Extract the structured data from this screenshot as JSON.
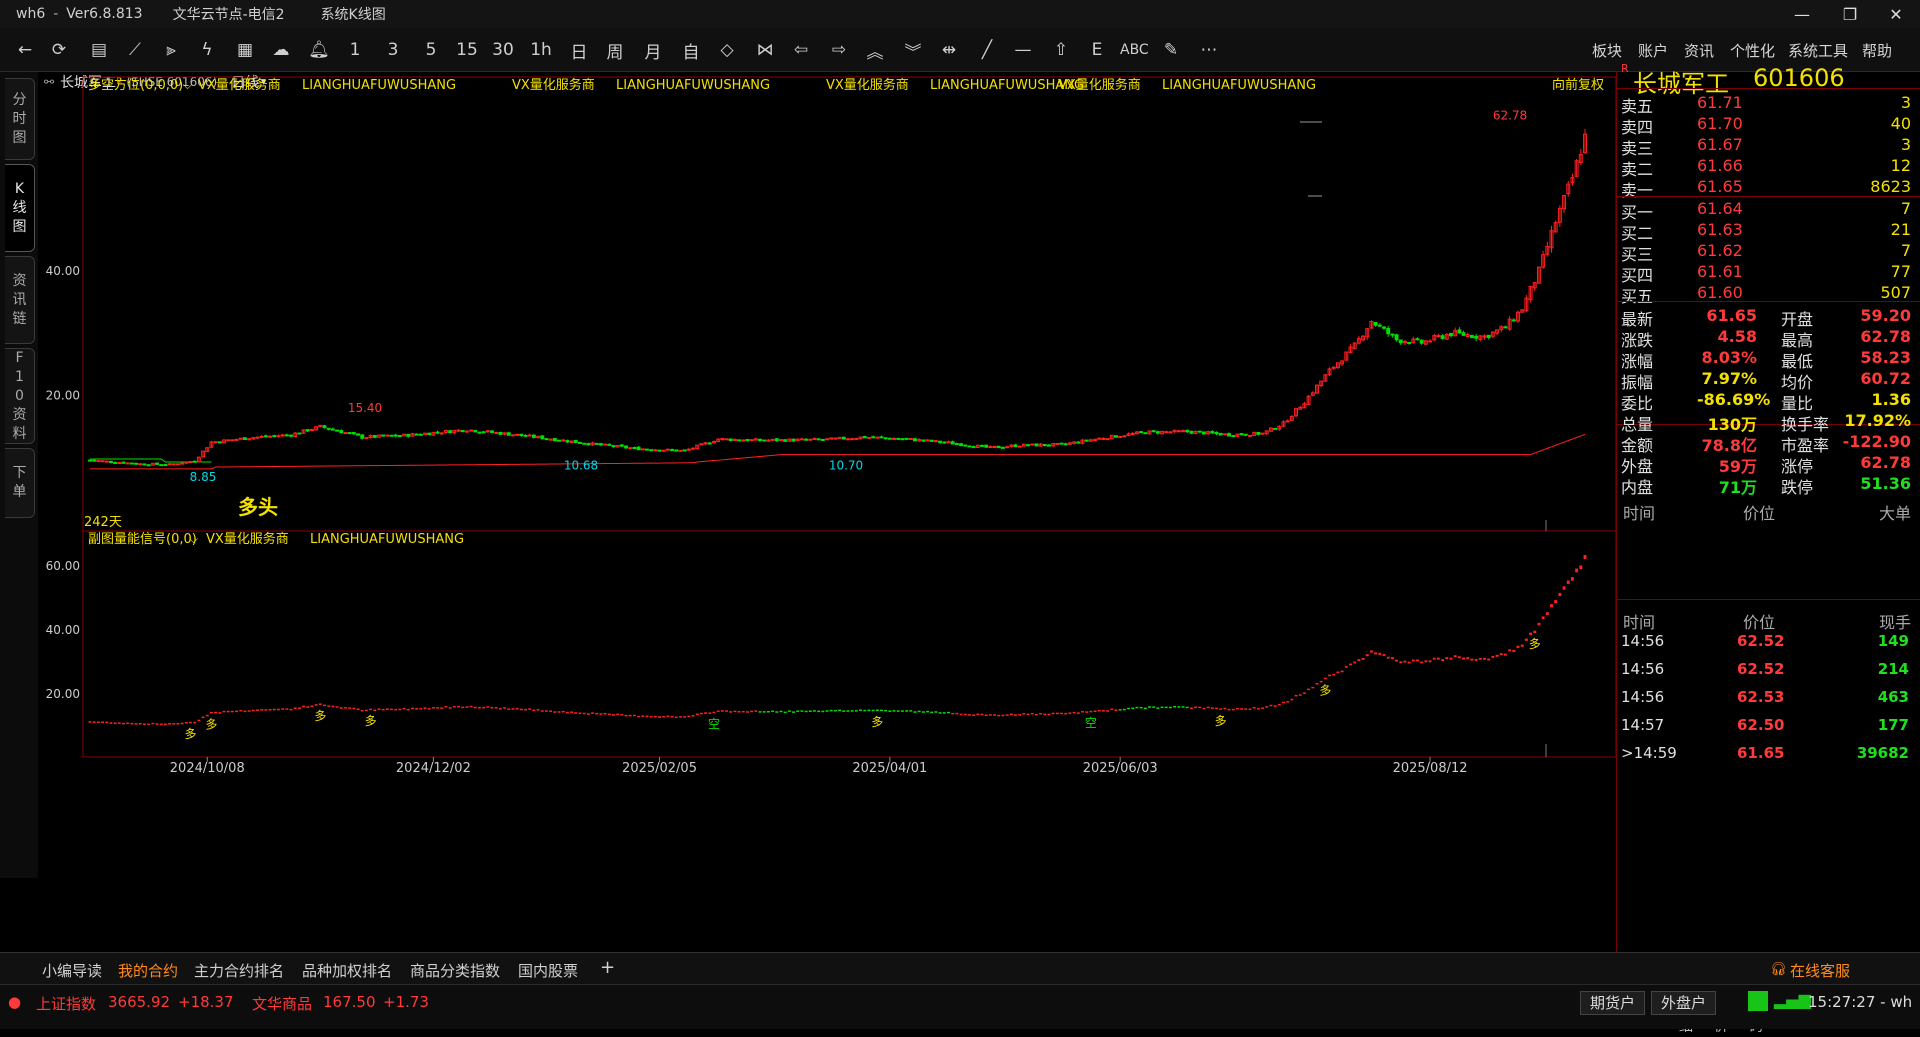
{
  "window": {
    "app": "wh6",
    "version": "Ver6.8.813",
    "server": "文华云节点-电信2",
    "view": "系统K线图"
  },
  "toolbar": {
    "periods": [
      "1",
      "3",
      "5",
      "15",
      "30",
      "1h",
      "日",
      "周",
      "月",
      "自"
    ],
    "extra_text": "ABC",
    "menus": [
      "板块",
      "账户",
      "资讯",
      "个性化",
      "系统工具",
      "帮助"
    ]
  },
  "left_tabs": [
    {
      "label": "分时图"
    },
    {
      "label": "K线图",
      "active": true
    },
    {
      "label": "资讯链"
    },
    {
      "label": "F10资料"
    },
    {
      "label": "下单"
    }
  ],
  "stock_header": {
    "name": "长城军工",
    "badge": "R",
    "code": "(SHSE 601606)",
    "period": "日线"
  },
  "main_panel": {
    "indicator": "多空方位(0,0,0)",
    "sponsor": "VX量化服务商",
    "sponsor_en": "LIANGHUAFUWUSHANG",
    "adjust": "向前复权",
    "signal_label": "多头",
    "days": "242天",
    "annotations": {
      "high": "62.78",
      "peak": "15.40",
      "low1": "8.85",
      "low2": "10.68",
      "low3": "10.70"
    }
  },
  "sub_panel": {
    "indicator": "副图量能信号(0,0)",
    "sponsor": "VX量化服务商",
    "sponsor_en": "LIANGHUAFUWUSHANG",
    "long_label": "多",
    "short_label": "空"
  },
  "x_axis": {
    "dates": [
      "2024/10/08",
      "2024/12/02",
      "2025/02/05",
      "2025/04/01",
      "2025/06/03",
      "2025/08/12"
    ]
  },
  "y_axis": {
    "main": [
      "40.00",
      "20.00"
    ],
    "sub": [
      "60.00",
      "40.00",
      "20.00"
    ]
  },
  "quote": {
    "title": "长城军工",
    "code": "601606",
    "badge": "R",
    "asks": [
      {
        "label": "卖五",
        "price": "61.71",
        "vol": "3"
      },
      {
        "label": "卖四",
        "price": "61.70",
        "vol": "40"
      },
      {
        "label": "卖三",
        "price": "61.67",
        "vol": "3"
      },
      {
        "label": "卖二",
        "price": "61.66",
        "vol": "12"
      },
      {
        "label": "卖一",
        "price": "61.65",
        "vol": "8623"
      }
    ],
    "bids": [
      {
        "label": "买一",
        "price": "61.64",
        "vol": "7"
      },
      {
        "label": "买二",
        "price": "61.63",
        "vol": "21"
      },
      {
        "label": "买三",
        "price": "61.62",
        "vol": "7"
      },
      {
        "label": "买四",
        "price": "61.61",
        "vol": "77"
      },
      {
        "label": "买五",
        "price": "61.60",
        "vol": "507"
      }
    ],
    "stats": [
      {
        "l1": "最新",
        "v1": "61.65",
        "c1": "#ff3a3a",
        "l2": "开盘",
        "v2": "59.20",
        "c2": "#ff3a3a"
      },
      {
        "l1": "涨跌",
        "v1": "4.58",
        "c1": "#ff3a3a",
        "l2": "最高",
        "v2": "62.78",
        "c2": "#ff3a3a"
      },
      {
        "l1": "涨幅",
        "v1": "8.03%",
        "c1": "#ff3a3a",
        "l2": "最低",
        "v2": "58.23",
        "c2": "#ff3a3a"
      },
      {
        "l1": "振幅",
        "v1": "7.97%",
        "c1": "#f4e000",
        "l2": "均价",
        "v2": "60.72",
        "c2": "#ff3a3a"
      },
      {
        "l1": "委比",
        "v1": "-86.69%",
        "c1": "#f4e000",
        "l2": "量比",
        "v2": "1.36",
        "c2": "#f4e000"
      },
      {
        "l1": "总量",
        "v1": "130万",
        "c1": "#f4e000",
        "l2": "换手率",
        "v2": "17.92%",
        "c2": "#f4e000"
      },
      {
        "l1": "金额",
        "v1": "78.8亿",
        "c1": "#ff3a3a",
        "l2": "市盈率",
        "v2": "-122.90",
        "c2": "#ff3a3a"
      },
      {
        "l1": "外盘",
        "v1": "59万",
        "c1": "#ff3a3a",
        "l2": "涨停",
        "v2": "62.78",
        "c2": "#ff3a3a"
      },
      {
        "l1": "内盘",
        "v1": "71万",
        "c1": "#1ee01e",
        "l2": "跌停",
        "v2": "51.36",
        "c2": "#1ee01e"
      }
    ],
    "big_header": [
      "时间",
      "价位",
      "大单"
    ],
    "tick_header": [
      "时间",
      "价位",
      "现手"
    ],
    "ticks": [
      {
        "time": "14:56",
        "price": "62.52",
        "vol": "149"
      },
      {
        "time": "14:56",
        "price": "62.52",
        "vol": "214"
      },
      {
        "time": "14:56",
        "price": "62.53",
        "vol": "463"
      },
      {
        "time": "14:57",
        "price": "62.50",
        "vol": "177"
      },
      {
        "time": ">14:59",
        "price": "61.65",
        "vol": "39682"
      }
    ],
    "tabs": [
      "明细",
      "分价",
      "筹码"
    ]
  },
  "bottom_tabs": [
    "小编导读",
    "我的合约",
    "主力合约排名",
    "品种加权排名",
    "商品分类指数",
    "国内股票"
  ],
  "active_bottom_tab": 1,
  "service": "在线客服",
  "status": {
    "index1_name": "上证指数",
    "index1_value": "3665.92",
    "index1_change": "+18.37",
    "index2_name": "文华商品",
    "index2_value": "167.50",
    "index2_change": "+1.73",
    "btn1": "期货户",
    "btn2": "外盘户",
    "time": "15:27:27 - wh"
  },
  "colors": {
    "up": "#ff2020",
    "down": "#00e000",
    "label": "#f4e000",
    "cyan": "#00d8e8"
  },
  "chart_data": {
    "type": "candlestick",
    "title": "长城军工 (SHSE 601606) 日线",
    "x_labels": [
      "2024/10/08",
      "2024/12/02",
      "2025/02/05",
      "2025/04/01",
      "2025/06/03",
      "2025/08/12"
    ],
    "main_ylim": [
      4,
      64
    ],
    "main_ticks": [
      20,
      40
    ],
    "sub_ylim": [
      5,
      65
    ],
    "sub_ticks": [
      20,
      40,
      60
    ],
    "key_points": [
      {
        "label": "8.85",
        "value": 8.85,
        "kind": "low"
      },
      {
        "label": "15.40",
        "value": 15.4,
        "kind": "high"
      },
      {
        "label": "10.68",
        "value": 10.68,
        "kind": "low"
      },
      {
        "label": "10.70",
        "value": 10.7,
        "kind": "low"
      },
      {
        "label": "62.78",
        "value": 62.78,
        "kind": "high"
      }
    ],
    "price_path": [
      [
        0,
        9.6
      ],
      [
        12,
        9.0
      ],
      [
        19,
        8.9
      ],
      [
        25,
        9.5
      ],
      [
        29,
        12.5
      ],
      [
        38,
        13.2
      ],
      [
        48,
        13.7
      ],
      [
        55,
        15.0
      ],
      [
        60,
        14.2
      ],
      [
        65,
        13.3
      ],
      [
        75,
        13.6
      ],
      [
        90,
        14.5
      ],
      [
        100,
        13.8
      ],
      [
        108,
        13.2
      ],
      [
        120,
        12.2
      ],
      [
        130,
        11.5
      ],
      [
        142,
        11.1
      ],
      [
        150,
        13.0
      ],
      [
        160,
        12.8
      ],
      [
        175,
        12.9
      ],
      [
        185,
        13.3
      ],
      [
        195,
        13.0
      ],
      [
        205,
        12.4
      ],
      [
        215,
        11.6
      ],
      [
        222,
        12.0
      ],
      [
        232,
        12.1
      ],
      [
        242,
        13.2
      ],
      [
        252,
        14.1
      ],
      [
        262,
        14.2
      ],
      [
        272,
        13.7
      ],
      [
        280,
        13.9
      ],
      [
        285,
        15.5
      ],
      [
        290,
        19.0
      ],
      [
        296,
        24.0
      ],
      [
        302,
        28.0
      ],
      [
        306,
        32.0
      ],
      [
        312,
        29.0
      ],
      [
        318,
        28.5
      ],
      [
        325,
        30.0
      ],
      [
        333,
        29.5
      ],
      [
        338,
        31.0
      ],
      [
        342,
        34.0
      ],
      [
        346,
        40.0
      ],
      [
        350,
        48.0
      ],
      [
        354,
        55.0
      ],
      [
        357,
        61.7
      ]
    ]
  }
}
